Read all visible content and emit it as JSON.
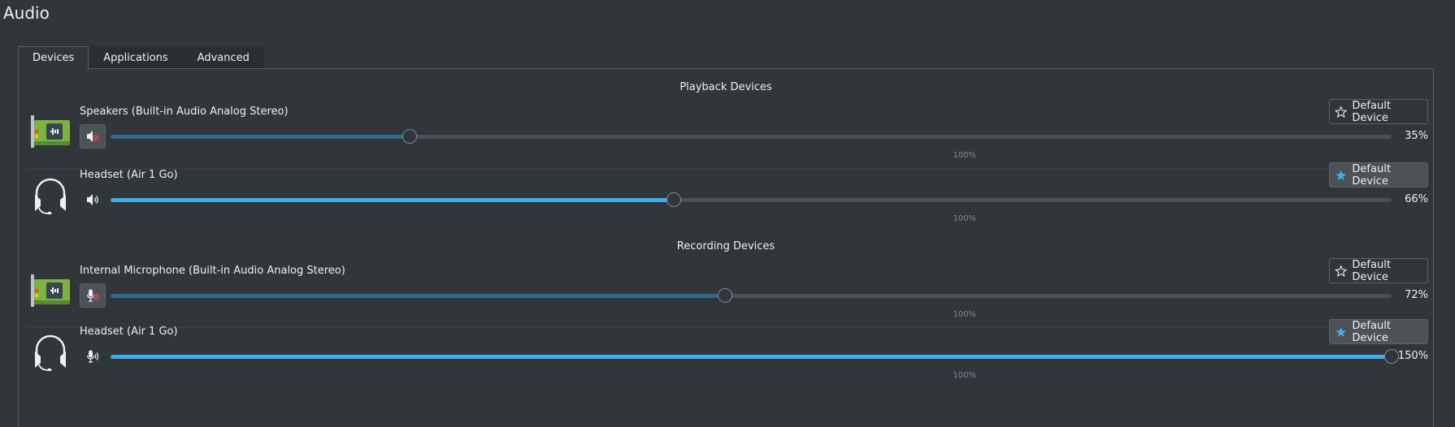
{
  "window": {
    "title": "Audio"
  },
  "tabs": [
    {
      "label": "Devices",
      "active": true
    },
    {
      "label": "Applications",
      "active": false
    },
    {
      "label": "Advanced",
      "active": false
    }
  ],
  "playback": {
    "section_title": "Playback Devices",
    "devices": [
      {
        "name": "Speakers (Built-in Audio Analog Stereo)",
        "icon": "sound-card-icon",
        "volume_percent": 35,
        "volume_label": "35%",
        "hundred_mark": "100%",
        "muted": true,
        "is_default": false,
        "default_label": "Default Device"
      },
      {
        "name": "Headset (Air 1 Go)",
        "icon": "headset-icon",
        "volume_percent": 66,
        "volume_label": "66%",
        "hundred_mark": "100%",
        "muted": false,
        "is_default": true,
        "default_label": "Default Device"
      }
    ]
  },
  "recording": {
    "section_title": "Recording Devices",
    "devices": [
      {
        "name": "Internal Microphone (Built-in Audio Analog Stereo)",
        "icon": "sound-card-icon",
        "volume_percent": 72,
        "volume_label": "72%",
        "hundred_mark": "100%",
        "muted": true,
        "is_default": false,
        "default_label": "Default Device"
      },
      {
        "name": "Headset (Air 1 Go)",
        "icon": "headset-icon",
        "volume_percent": 150,
        "volume_label": "150%",
        "hundred_mark": "100%",
        "muted": false,
        "is_default": true,
        "default_label": "Default Device"
      }
    ]
  },
  "slider_max_percent": 150,
  "colors": {
    "accent": "#3daee9",
    "muted_fill": "#2c6b8a",
    "background": "#31363b",
    "mute_indicator": "#da4453"
  }
}
